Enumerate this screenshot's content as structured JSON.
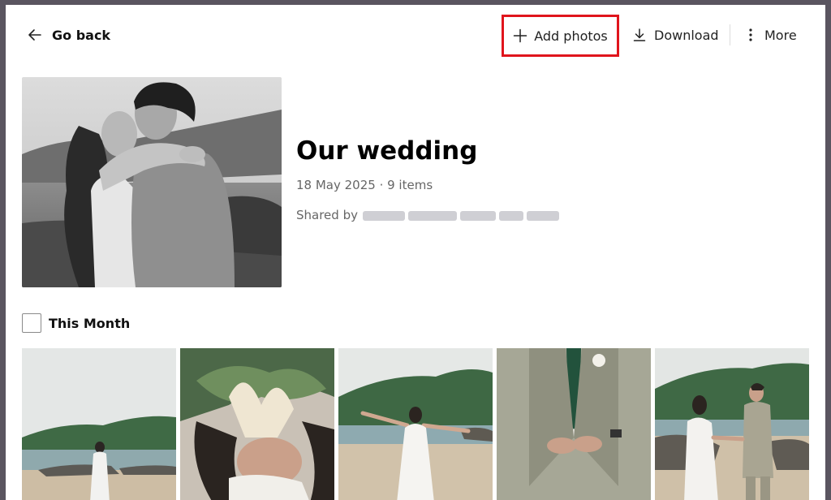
{
  "toolbar": {
    "back_label": "Go back",
    "add_label": "Add photos",
    "download_label": "Download",
    "more_label": "More"
  },
  "album": {
    "title": "Our wedding",
    "meta": "18 May 2025 · 9 items",
    "shared_prefix": "Shared by"
  },
  "section": {
    "label": "This Month"
  },
  "colors": {
    "highlight": "#e0141c",
    "background": "#ffffff",
    "frame": "#5a5560",
    "muted_text": "#666666"
  },
  "icons": {
    "back": "arrow-left-icon",
    "add": "plus-icon",
    "download": "download-icon",
    "more": "vertical-ellipsis-icon"
  }
}
